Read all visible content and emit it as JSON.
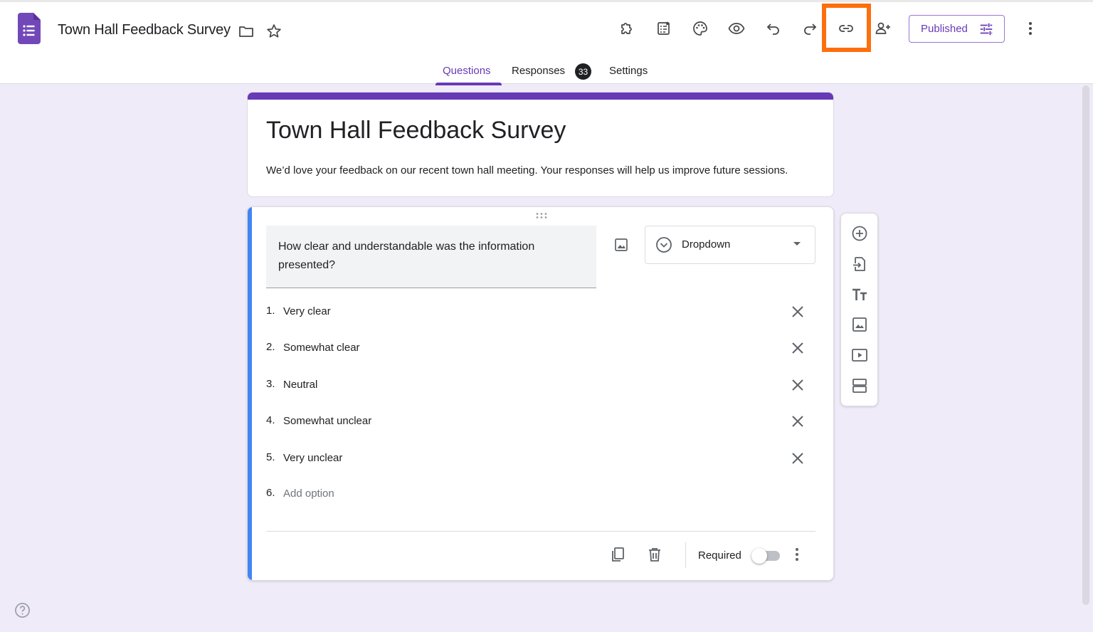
{
  "header": {
    "doc_title": "Town Hall Feedback Survey",
    "publish_label": "Published"
  },
  "tabs": [
    {
      "label": "Questions",
      "active": true
    },
    {
      "label": "Responses",
      "badge": "33"
    },
    {
      "label": "Settings"
    }
  ],
  "form": {
    "title": "Town Hall Feedback Survey",
    "description": "We’d love your feedback on our recent town hall meeting. Your responses will help us improve future sessions."
  },
  "question": {
    "text": "How clear and understandable was the information presented?",
    "type": "Dropdown",
    "options": [
      {
        "num": "1.",
        "label": "Very clear"
      },
      {
        "num": "2.",
        "label": "Somewhat clear"
      },
      {
        "num": "3.",
        "label": "Neutral"
      },
      {
        "num": "4.",
        "label": "Somewhat unclear"
      },
      {
        "num": "5.",
        "label": "Very unclear"
      }
    ],
    "add_option": {
      "num": "6.",
      "label": "Add option"
    },
    "required_label": "Required",
    "required": false
  },
  "colors": {
    "brand": "#673ab7",
    "background": "#f0ebf8",
    "active_question_bar": "#4285f4",
    "highlight": "#fd6f0d"
  },
  "icons": {
    "toolbar": [
      "addon-icon",
      "form-checklist-icon",
      "palette-icon",
      "preview-eye-icon",
      "undo-icon",
      "redo-icon",
      "link-icon",
      "add-collaborator-icon",
      "more-vert-icon"
    ],
    "side_tools": [
      "add-question-icon",
      "import-questions-icon",
      "add-title-icon",
      "add-image-icon",
      "add-video-icon",
      "add-section-icon"
    ]
  }
}
